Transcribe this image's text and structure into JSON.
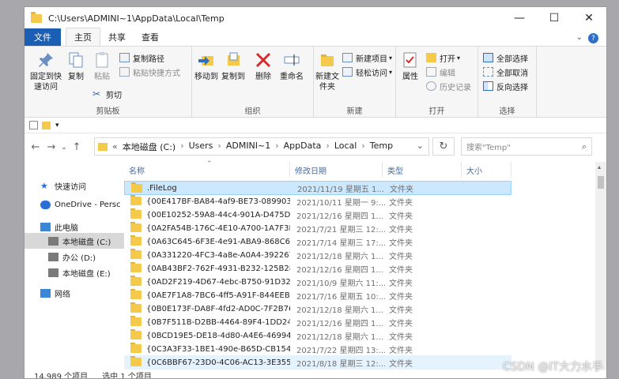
{
  "window": {
    "title": "C:\\Users\\ADMINI~1\\AppData\\Local\\Temp",
    "minimize": "—",
    "maximize": "☐",
    "close": "✕"
  },
  "tabs": [
    "文件",
    "主页",
    "共享",
    "查看"
  ],
  "ribbon": {
    "clipboard": {
      "pin": "固定到快速访问",
      "copy": "复制",
      "paste": "粘贴",
      "copy_path": "复制路径",
      "paste_shortcut": "粘贴快捷方式",
      "cut": "剪切",
      "label": "剪贴板"
    },
    "organize": {
      "move_to": "移动到",
      "copy_to": "复制到",
      "delete": "删除",
      "rename": "重命名",
      "label": "组织"
    },
    "new": {
      "new_folder": "新建文件夹",
      "new_item": "新建项目",
      "easy_access": "轻松访问",
      "label": "新建"
    },
    "open": {
      "properties": "属性",
      "open": "打开",
      "edit": "编辑",
      "history": "历史记录",
      "label": "打开"
    },
    "select": {
      "select_all": "全部选择",
      "select_none": "全部取消",
      "invert": "反向选择",
      "label": "选择"
    }
  },
  "address": {
    "prefix": "«",
    "parts": [
      "本地磁盘 (C:)",
      "Users",
      "ADMINI~1",
      "AppData",
      "Local",
      "Temp"
    ],
    "sep": "›",
    "dropdown": "⌄",
    "refresh": "↻",
    "search_placeholder": "搜索\"Temp\"",
    "search_icon": "⌕"
  },
  "nav_buttons": {
    "back": "←",
    "forward": "→",
    "recent": "⌄",
    "up": "↑"
  },
  "navpane": [
    {
      "label": "快速访问",
      "icon": "star-icon",
      "color": "#2b6fd6"
    },
    {
      "label": "OneDrive - Persc",
      "icon": "cloud-icon",
      "color": "#2b6fd6"
    },
    {
      "label": "此电脑",
      "icon": "computer-icon",
      "color": "#3a86d8"
    },
    {
      "label": "本地磁盘 (C:)",
      "icon": "drive-icon",
      "color": "#7a7a7a"
    },
    {
      "label": "办公 (D:)",
      "icon": "drive-icon",
      "color": "#7a7a7a"
    },
    {
      "label": "本地磁盘 (E:)",
      "icon": "drive-icon",
      "color": "#7a7a7a"
    },
    {
      "label": "网络",
      "icon": "network-icon",
      "color": "#3a86d8"
    }
  ],
  "columns": {
    "name": "名称",
    "date": "修改日期",
    "type": "类型",
    "size": "大小",
    "sort": "⌃"
  },
  "files": [
    {
      "name": ".FileLog",
      "date": "2021/11/19 星期五 1...",
      "type": "文件夹",
      "selected": true
    },
    {
      "name": "{00E417BF-BA84-4af9-BE73-089903A...",
      "date": "2021/10/11 星期一 9:...",
      "type": "文件夹"
    },
    {
      "name": "{00E10252-59A8-44c4-901A-D475D1...",
      "date": "2021/12/16 星期四 1...",
      "type": "文件夹"
    },
    {
      "name": "{0A2FA54B-176C-4E10-A700-1A7F3D...",
      "date": "2021/7/21 星期三 12:...",
      "type": "文件夹"
    },
    {
      "name": "{0A63C645-6F3E-4e91-ABA9-868C6C...",
      "date": "2021/7/14 星期三 17:...",
      "type": "文件夹"
    },
    {
      "name": "{0A331220-4FC3-4a8e-A0A4-3922677...",
      "date": "2021/12/18 星期六 1...",
      "type": "文件夹"
    },
    {
      "name": "{0AB43BF2-762F-4931-B232-125B287...",
      "date": "2021/12/16 星期四 1...",
      "type": "文件夹"
    },
    {
      "name": "{0AD2F219-4D67-4ebc-B750-91D32F...",
      "date": "2021/10/9 星期六 11:...",
      "type": "文件夹"
    },
    {
      "name": "{0AE7F1A8-7BC6-4ff5-A91F-844EEBB...",
      "date": "2021/7/16 星期五 10:...",
      "type": "文件夹"
    },
    {
      "name": "{0B0E173F-DA8F-4fd2-AD0C-7F2B763...",
      "date": "2021/12/18 星期六 1...",
      "type": "文件夹"
    },
    {
      "name": "{0B7F511B-D2BB-4464-89F4-1DD24D...",
      "date": "2021/12/16 星期四 1...",
      "type": "文件夹"
    },
    {
      "name": "{0BCD19E5-DE18-4d80-A4E6-469945...",
      "date": "2021/12/18 星期六 1...",
      "type": "文件夹"
    },
    {
      "name": "{0C3A3F33-1BE1-490e-B65D-CB154C...",
      "date": "2021/7/22 星期四 13:...",
      "type": "文件夹"
    },
    {
      "name": "{0C6BBF67-23D0-4C06-AC13-3E355A...",
      "date": "2021/8/18 星期三 12:...",
      "type": "文件夹",
      "hover": true
    }
  ],
  "status": {
    "count": "14,989 个项目",
    "selected": "选中 1 个项目"
  },
  "watermark": "CSDN @IT大力水手",
  "colors": {
    "accent": "#1a5fb4",
    "folder": "#f5c94a",
    "selection": "#cce8ff"
  }
}
